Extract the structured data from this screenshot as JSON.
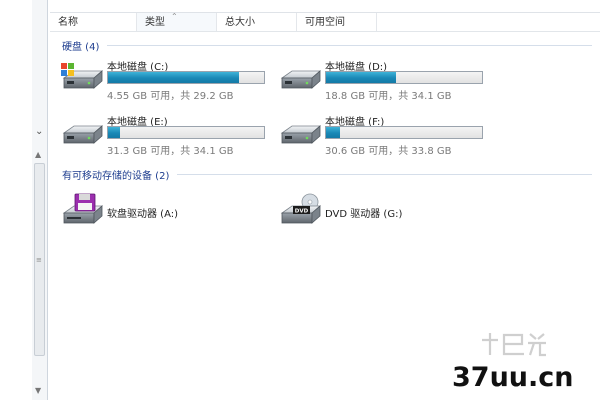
{
  "columns": {
    "name": "名称",
    "type": "类型",
    "total_size": "总大小",
    "free_space": "可用空间"
  },
  "hard_disks": {
    "title": "硬盘 (4)",
    "drives": [
      {
        "name": "本地磁盘 (C:)",
        "free_text": "4.55 GB 可用，共 29.2 GB",
        "used_fraction": 0.84,
        "icon": "windows-drive-icon"
      },
      {
        "name": "本地磁盘 (D:)",
        "free_text": "18.8 GB 可用，共 34.1 GB",
        "used_fraction": 0.45,
        "icon": "hard-drive-icon"
      },
      {
        "name": "本地磁盘 (E:)",
        "free_text": "31.3 GB 可用，共 34.1 GB",
        "used_fraction": 0.08,
        "icon": "hard-drive-icon"
      },
      {
        "name": "本地磁盘 (F:)",
        "free_text": "30.6 GB 可用，共 33.8 GB",
        "used_fraction": 0.09,
        "icon": "hard-drive-icon"
      }
    ]
  },
  "removable": {
    "title": "有可移动存储的设备 (2)",
    "devices": [
      {
        "name": "软盘驱动器 (A:)",
        "icon": "floppy-drive-icon"
      },
      {
        "name": "DVD 驱动器 (G:)",
        "icon": "dvd-drive-icon",
        "badge": "DVD"
      }
    ]
  },
  "watermark": {
    "text": "37uu.cn"
  },
  "colors": {
    "bar_fill": "#1a88b6",
    "group_title": "#1e3d8f",
    "free_text": "#7a7a7a"
  }
}
